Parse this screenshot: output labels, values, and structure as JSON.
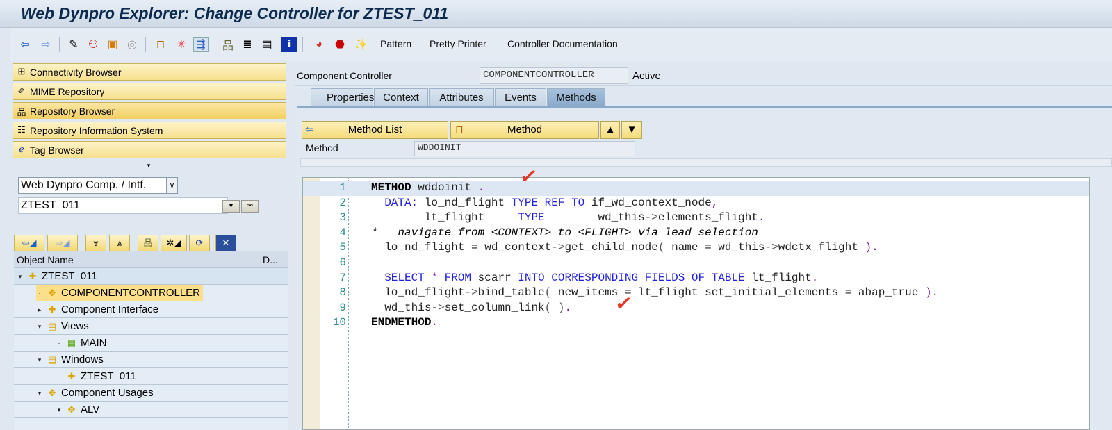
{
  "title": "Web Dynpro Explorer: Change Controller for ZTEST_011",
  "toolbar": {
    "icons": [
      "back-icon",
      "forward-icon",
      "edit-icon",
      "active-inactive-icon",
      "other-object-icon",
      "where-used-icon",
      "display-object-list-icon",
      "highlight-icon",
      "navigate-icon",
      "hierarchy-icon",
      "stack-icon",
      "window-icon",
      "info-icon",
      "checks-icon",
      "stop-icon",
      "wizard-icon"
    ],
    "pattern": "Pattern",
    "pretty_printer": "Pretty Printer",
    "controller_doc": "Controller Documentation"
  },
  "nav": [
    "Connectivity Browser",
    "MIME Repository",
    "Repository Browser",
    "Repository Information System",
    "Tag Browser"
  ],
  "object_type": "Web Dynpro Comp. / Intf.",
  "object_name": "ZTEST_011",
  "tree": {
    "col_name": "Object Name",
    "col_desc": "D...",
    "rows": [
      {
        "label": "ZTEST_011",
        "level": 0,
        "exp": "▾"
      },
      {
        "label": "COMPONENTCONTROLLER",
        "level": 1,
        "exp": "·"
      },
      {
        "label": "Component Interface",
        "level": 1,
        "exp": "▸"
      },
      {
        "label": "Views",
        "level": 1,
        "exp": "▾"
      },
      {
        "label": "MAIN",
        "level": 2,
        "exp": "·"
      },
      {
        "label": "Windows",
        "level": 1,
        "exp": "▾"
      },
      {
        "label": "ZTEST_011",
        "level": 2,
        "exp": "·"
      },
      {
        "label": "Component Usages",
        "level": 1,
        "exp": "▾"
      },
      {
        "label": "ALV",
        "level": 2,
        "exp": "▾"
      }
    ]
  },
  "controller": {
    "label": "Component Controller",
    "name": "COMPONENTCONTROLLER",
    "status": "Active"
  },
  "tabs": [
    "Properties",
    "Context",
    "Attributes",
    "Events",
    "Methods"
  ],
  "method_list": "Method List",
  "method_btn": "Method",
  "method_label": "Method",
  "method_name": "WDDOINIT",
  "code": [
    [
      {
        "t": "METHOD",
        "c": "b"
      },
      {
        "t": " wddoinit ",
        "c": "n"
      },
      {
        "t": ".",
        "c": "p"
      }
    ],
    [
      {
        "t": "  DATA:",
        "c": "k"
      },
      {
        "t": " lo_nd_flight ",
        "c": "n"
      },
      {
        "t": "TYPE REF TO",
        "c": "k"
      },
      {
        "t": " if_wd_context_node",
        "c": "n"
      },
      {
        "t": ",",
        "c": "p"
      }
    ],
    [
      {
        "t": "        lt_flight     ",
        "c": "n"
      },
      {
        "t": "TYPE",
        "c": "k"
      },
      {
        "t": "        wd_this",
        "c": "n"
      },
      {
        "t": "->",
        "c": "o"
      },
      {
        "t": "elements_flight",
        "c": "n"
      },
      {
        "t": ".",
        "c": "p"
      }
    ],
    [
      {
        "t": "*   navigate from <CONTEXT> to <FLIGHT> via lead selection",
        "c": "c"
      }
    ],
    [
      {
        "t": "  lo_nd_flight = wd_context",
        "c": "n"
      },
      {
        "t": "->",
        "c": "o"
      },
      {
        "t": "get_child_node",
        "c": "n"
      },
      {
        "t": "(",
        "c": "o"
      },
      {
        "t": " name = wd_this",
        "c": "n"
      },
      {
        "t": "->",
        "c": "o"
      },
      {
        "t": "wdctx_flight ",
        "c": "n"
      },
      {
        "t": ").",
        "c": "p"
      }
    ],
    [],
    [
      {
        "t": "  SELECT",
        "c": "k"
      },
      {
        "t": " * ",
        "c": "p"
      },
      {
        "t": "FROM",
        "c": "k"
      },
      {
        "t": " scarr ",
        "c": "n"
      },
      {
        "t": "INTO CORRESPONDING FIELDS OF TABLE",
        "c": "k"
      },
      {
        "t": " lt_flight",
        "c": "n"
      },
      {
        "t": ".",
        "c": "p"
      }
    ],
    [
      {
        "t": "  lo_nd_flight",
        "c": "n"
      },
      {
        "t": "->",
        "c": "o"
      },
      {
        "t": "bind_table",
        "c": "n"
      },
      {
        "t": "(",
        "c": "o"
      },
      {
        "t": " new_items = lt_flight set_initial_elements = abap_true ",
        "c": "n"
      },
      {
        "t": ").",
        "c": "p"
      }
    ],
    [
      {
        "t": "  wd_this",
        "c": "n"
      },
      {
        "t": "->",
        "c": "o"
      },
      {
        "t": "set_column_link",
        "c": "n"
      },
      {
        "t": "( )",
        "c": "o"
      },
      {
        "t": ".",
        "c": "p"
      }
    ],
    [
      {
        "t": "ENDMETHOD",
        "c": "b"
      },
      {
        "t": ".",
        "c": "p"
      }
    ]
  ]
}
